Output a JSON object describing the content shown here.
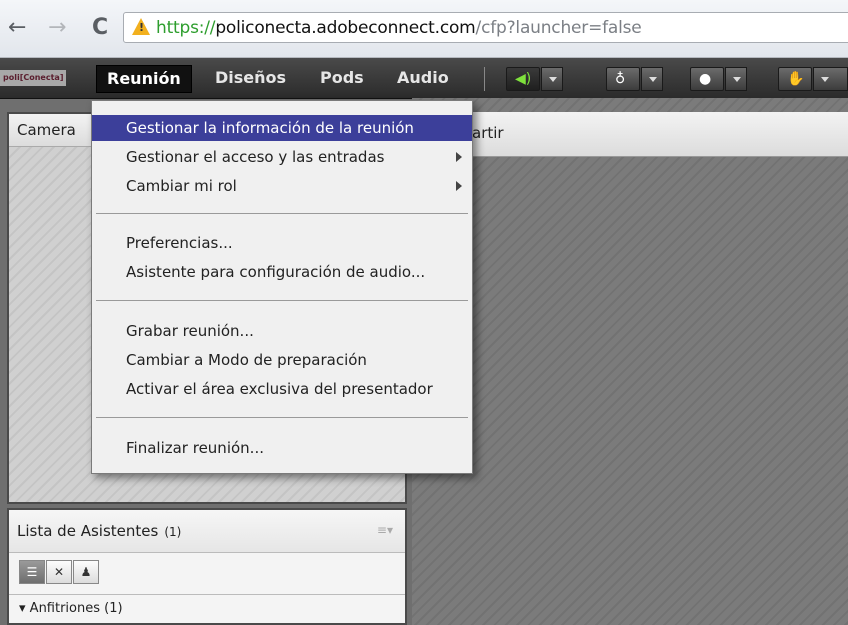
{
  "browser": {
    "url_scheme": "https://",
    "url_domain": "policonecta.adobeconnect.com",
    "url_path": "/cfp?launcher=false"
  },
  "app": {
    "logo_text": "poli[Conecta]",
    "menus": [
      "Reunión",
      "Diseños",
      "Pods",
      "Audio"
    ]
  },
  "toolbar": {
    "speaker_icon": "speaker-icon",
    "mic_icon": "microphone-icon",
    "camera_icon": "webcam-icon",
    "status_icon": "raise-hand-icon"
  },
  "pods": {
    "camera_title": "Camera",
    "share_title": "artir"
  },
  "attendees": {
    "title": "Lista de Asistentes",
    "count": "(1)",
    "group": "Anfitriones (1)"
  },
  "dropdown": {
    "items": [
      "Gestionar la información de la reunión",
      "Gestionar el acceso y las entradas",
      "Cambiar mi rol",
      "Preferencias...",
      "Asistente para configuración de audio...",
      "Grabar reunión...",
      "Cambiar a Modo de preparación",
      "Activar el área exclusiva del presentador",
      "Finalizar reunión..."
    ]
  },
  "colors": {
    "highlight": "#3c3f9a",
    "speaker_active": "#7fe23c",
    "url_scheme": "#2e9e2e"
  }
}
